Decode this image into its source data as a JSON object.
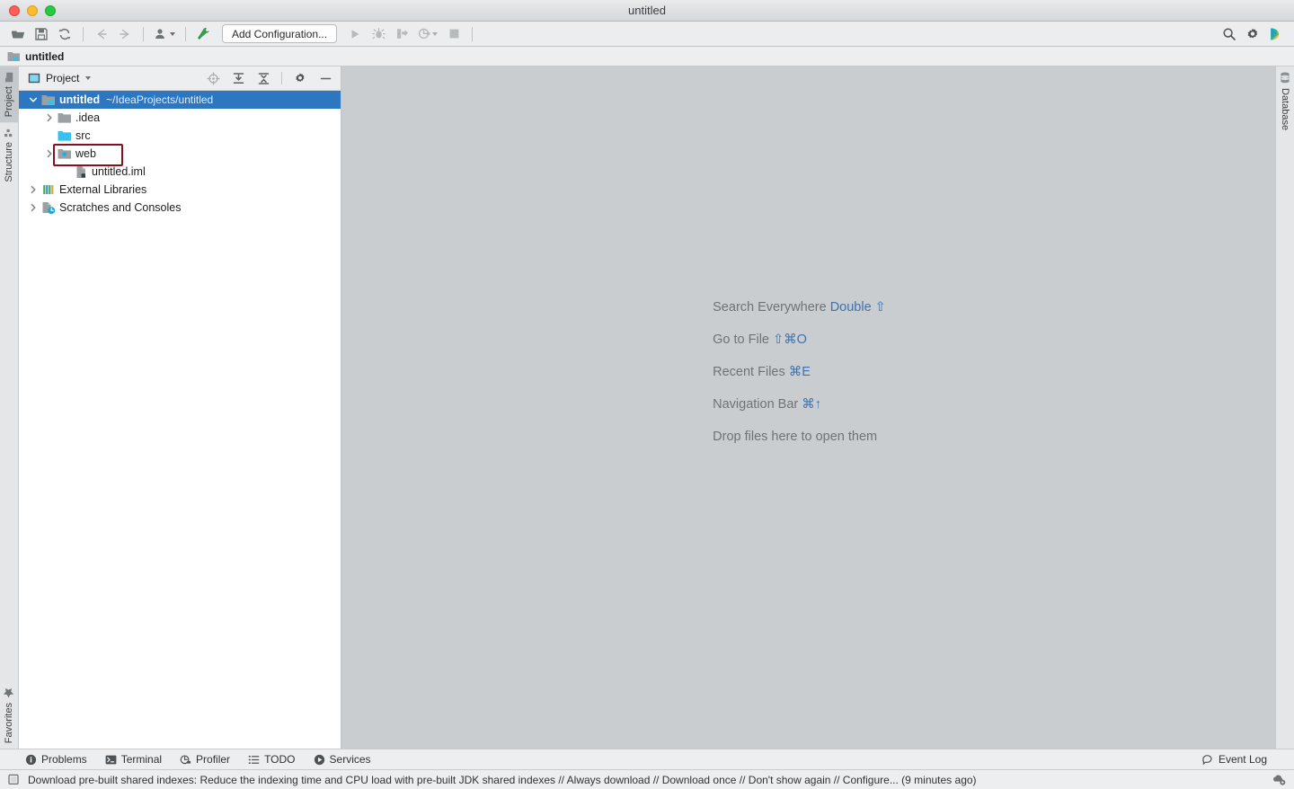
{
  "window": {
    "title": "untitled",
    "traffic_lights": [
      "close-button",
      "minimize-button",
      "zoom-button"
    ]
  },
  "toolbar": {
    "open_label": "Open",
    "save_label": "Save All",
    "sync_label": "Synchronize",
    "back_label": "Back",
    "forward_label": "Forward",
    "vcs_label": "VCS Operations",
    "build_label": "Build Project",
    "run_config_label": "Add Configuration...",
    "run_label": "Run",
    "debug_label": "Debug",
    "run_coverage_label": "Run with Coverage",
    "profile_label": "Profile",
    "stop_label": "Stop",
    "search_label": "Search Everywhere",
    "settings_label": "Settings",
    "ide_label": "IDE Services"
  },
  "navbar": {
    "project_label": "untitled"
  },
  "left_stripe": {
    "top_tabs": [
      {
        "label": "Project",
        "icon": "project-icon",
        "active": true
      },
      {
        "label": "Structure",
        "icon": "structure-icon",
        "active": false
      }
    ],
    "bottom_tabs": [
      {
        "label": "Favorites",
        "icon": "star-icon",
        "active": false
      }
    ]
  },
  "right_stripe": {
    "tabs": [
      {
        "label": "Database",
        "icon": "database-icon",
        "active": false
      }
    ]
  },
  "project_panel": {
    "title": "Project",
    "view_icon": "project-view-icon",
    "dropdown_icon": "chevron-down-icon",
    "actions": [
      {
        "name": "select-opened-file-button",
        "icon": "locate-icon"
      },
      {
        "name": "expand-all-button",
        "icon": "expand-all-icon"
      },
      {
        "name": "collapse-all-button",
        "icon": "collapse-all-icon"
      },
      {
        "name": "panel-settings-button",
        "icon": "gear-icon"
      },
      {
        "name": "hide-panel-button",
        "icon": "minimize-icon"
      }
    ],
    "tree": [
      {
        "label": "untitled",
        "path": "~/IdeaProjects/untitled",
        "indent": 0,
        "arrow": "expanded",
        "icon": "module-folder-icon",
        "selected": true,
        "bold": true
      },
      {
        "label": ".idea",
        "path": "",
        "indent": 1,
        "arrow": "collapsed",
        "icon": "folder-gray-icon",
        "selected": false,
        "bold": false
      },
      {
        "label": "src",
        "path": "",
        "indent": 1,
        "arrow": "none",
        "icon": "source-folder-icon",
        "selected": false,
        "bold": false
      },
      {
        "label": "web",
        "path": "",
        "indent": 1,
        "arrow": "collapsed",
        "icon": "web-folder-icon",
        "selected": false,
        "bold": false,
        "highlighted": true
      },
      {
        "label": "untitled.iml",
        "path": "",
        "indent": 2,
        "arrow": "none",
        "icon": "iml-file-icon",
        "selected": false,
        "bold": false
      },
      {
        "label": "External Libraries",
        "path": "",
        "indent": 0,
        "arrow": "collapsed",
        "icon": "libraries-icon",
        "selected": false,
        "bold": false
      },
      {
        "label": "Scratches and Consoles",
        "path": "",
        "indent": 0,
        "arrow": "collapsed",
        "icon": "scratches-icon",
        "selected": false,
        "bold": false
      }
    ]
  },
  "editor": {
    "tips": [
      {
        "text": "Search Everywhere",
        "key": "Double ⇧"
      },
      {
        "text": "Go to File",
        "key": "⇧⌘O"
      },
      {
        "text": "Recent Files",
        "key": "⌘E"
      },
      {
        "text": "Navigation Bar",
        "key": "⌘↑"
      },
      {
        "text": "Drop files here to open them",
        "key": ""
      }
    ]
  },
  "bottom_bar": {
    "items": [
      {
        "label": "Problems",
        "icon": "problems-icon"
      },
      {
        "label": "Terminal",
        "icon": "terminal-icon"
      },
      {
        "label": "Profiler",
        "icon": "profiler-icon"
      },
      {
        "label": "TODO",
        "icon": "todo-icon"
      },
      {
        "label": "Services",
        "icon": "services-icon"
      }
    ],
    "event_log": {
      "label": "Event Log",
      "icon": "event-log-icon"
    }
  },
  "status_bar": {
    "icon": "notification-icon",
    "message": "Download pre-built shared indexes: Reduce the indexing time and CPU load with pre-built JDK shared indexes // Always download // Download once // Don't show again // Configure... (9 minutes ago)",
    "right_icon": "cloud-settings-icon"
  },
  "colors": {
    "selection_blue": "#2d77c2",
    "accent_link": "#3f72ad",
    "editor_bg": "#c9cdd0",
    "panel_bg": "#eceeef",
    "annotation_red": "#8b0d20"
  }
}
